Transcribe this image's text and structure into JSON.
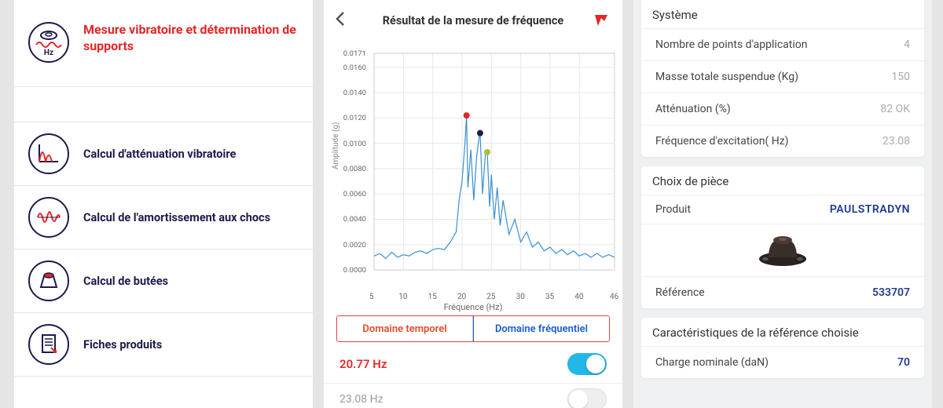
{
  "menu": {
    "items": [
      "Mesure vibratoire et détermination de supports",
      "Calcul d'atténuation vibratoire",
      "Calcul de l'amortissement aux chocs",
      "Calcul de butées",
      "Fiches produits"
    ]
  },
  "pane2": {
    "title": "Résultat de la mesure de fréquence",
    "seg_left": "Domaine temporel",
    "seg_right": "Domaine fréquentiel",
    "freq1": "20.77 Hz",
    "freq2": "23.08 Hz"
  },
  "chart_data": {
    "type": "line",
    "title": "",
    "xlabel": "Fréquence (Hz)",
    "ylabel": "Amplitude (g)",
    "xlim": [
      5,
      46
    ],
    "ylim": [
      0,
      0.0171
    ],
    "yticks": [
      0.0,
      0.002,
      0.004,
      0.006,
      0.008,
      0.01,
      0.012,
      0.014,
      0.016,
      0.0171
    ],
    "xticks": [
      5,
      10,
      15,
      20,
      25,
      30,
      35,
      40,
      46
    ],
    "series": [
      {
        "name": "amplitude",
        "color": "#3a8ed4",
        "x": [
          5,
          6,
          7,
          8,
          9,
          10,
          11,
          12,
          13,
          14,
          15,
          16,
          17,
          18,
          19,
          19.5,
          20,
          20.5,
          20.77,
          21,
          21.5,
          22,
          22.5,
          23,
          23.08,
          23.5,
          24,
          24.3,
          24.7,
          25,
          25.5,
          26,
          26.5,
          27,
          28,
          29,
          30,
          31,
          32,
          33,
          34,
          35,
          36,
          37,
          38,
          39,
          40,
          41,
          42,
          43,
          44,
          45,
          46
        ],
        "y": [
          0.0011,
          0.0013,
          0.0009,
          0.0014,
          0.001,
          0.0012,
          0.0011,
          0.0014,
          0.0015,
          0.0013,
          0.0016,
          0.0017,
          0.0016,
          0.0022,
          0.003,
          0.0055,
          0.007,
          0.01,
          0.0122,
          0.0065,
          0.0095,
          0.0055,
          0.009,
          0.0108,
          0.0108,
          0.006,
          0.0093,
          0.0093,
          0.005,
          0.0075,
          0.004,
          0.0065,
          0.0035,
          0.0055,
          0.0028,
          0.004,
          0.0022,
          0.003,
          0.0018,
          0.0022,
          0.0015,
          0.0018,
          0.0013,
          0.0016,
          0.0012,
          0.0015,
          0.0011,
          0.0013,
          0.001,
          0.0013,
          0.001,
          0.0012,
          0.001
        ]
      }
    ],
    "markers": [
      {
        "x": 20.77,
        "y": 0.0122,
        "color": "#e52627"
      },
      {
        "x": 23.08,
        "y": 0.0108,
        "color": "#1c1b4b"
      },
      {
        "x": 24.3,
        "y": 0.0093,
        "color": "#a7c23a"
      }
    ]
  },
  "system": {
    "title": "Système",
    "rows": [
      {
        "label": "Nombre de points d'application",
        "value": "4"
      },
      {
        "label": "Masse totale suspendue (Kg)",
        "value": "150"
      },
      {
        "label": "Atténuation (%)",
        "value": "82 OK"
      },
      {
        "label": "Fréquence d'excitation( Hz)",
        "value": "23.08"
      }
    ]
  },
  "piece": {
    "title": "Choix de pièce",
    "product_label": "Produit",
    "product_name": "PAULSTRADYN",
    "ref_label": "Référence",
    "ref_value": "533707"
  },
  "char": {
    "title": "Caractéristiques de la référence choisie",
    "rows": [
      {
        "label": "Charge nominale (daN)",
        "value": "70"
      }
    ]
  }
}
